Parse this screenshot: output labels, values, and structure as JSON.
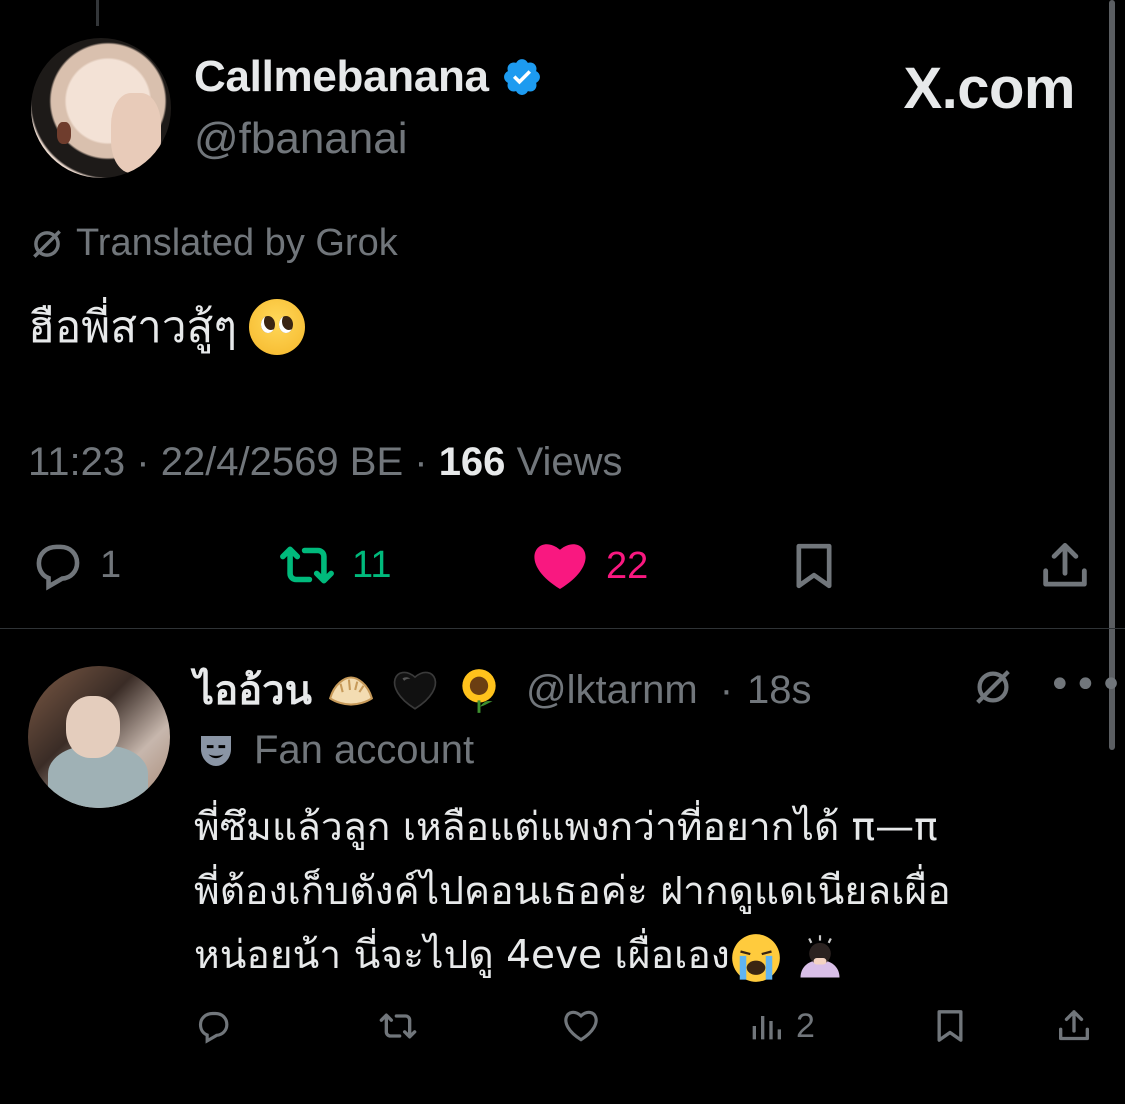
{
  "watermark": "X.com",
  "tweet": {
    "display_name": "Callmebanana",
    "handle": "@fbananai",
    "translated_label": "Translated by Grok",
    "text": "ฮือพี่สาวสู้ๆ",
    "time": "11:23",
    "date": "22/4/2569 BE",
    "views_count": "166",
    "views_label": "Views",
    "replies": "1",
    "retweets": "11",
    "likes": "22",
    "colors": {
      "retweet": "#00ba7c",
      "like": "#f91880",
      "verified": "#1d9bf0"
    }
  },
  "reply": {
    "display_name": "ไออ้วน",
    "handle": "@lktarnm",
    "time": "18s",
    "badge": "Fan account",
    "lines": [
      "พี่ซึมแล้วลูก เหลือแต่แพงกว่าที่อยากได้ π—π",
      "พี่ต้องเก็บตังค์ไปคอนเธอค่ะ ฝากดูแดเนียลเผื่อ",
      "หน่อยน้า นี่จะไปดู 4eve เผื่อเอง"
    ],
    "views": "2"
  }
}
